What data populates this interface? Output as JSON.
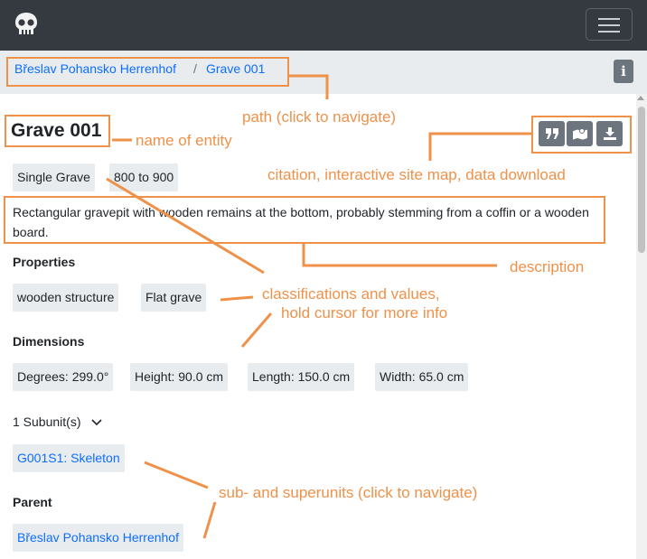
{
  "navbar": {
    "logo_icon": "skull-icon",
    "menu_icon": "hamburger-icon"
  },
  "breadcrumb": {
    "items": [
      "Břeslav Pohansko Herrenhof",
      "Grave 001"
    ],
    "separator": "/"
  },
  "info_button": {
    "label": "i"
  },
  "entity": {
    "title": "Grave 001",
    "actions": [
      "quote-icon",
      "map-icon",
      "download-icon"
    ],
    "tags": [
      "Single Grave",
      "800 to 900"
    ],
    "description": "Rectangular gravepit with wooden remains at the bottom, probably stemming from a coffin or a wooden board."
  },
  "properties": {
    "label": "Properties",
    "values": [
      "wooden structure",
      "Flat grave"
    ]
  },
  "dimensions": {
    "label": "Dimensions",
    "values": [
      "Degrees: 299.0°",
      "Height: 90.0 cm",
      "Length: 150.0 cm",
      "Width: 65.0 cm"
    ]
  },
  "subunits": {
    "toggle_label": "1 Subunit(s)",
    "items": [
      "G001S1: Skeleton"
    ]
  },
  "parent": {
    "label": "Parent",
    "items": [
      "Břeslav Pohansko Herrenhof"
    ]
  },
  "annotations": {
    "path": "path (click to navigate)",
    "name": "name of entity",
    "citation": "citation, interactive site map, data download",
    "description": "description",
    "classifications_1": "classifications and values,",
    "classifications_2": "hold cursor for more info",
    "subunits": "sub- and superunits (click to navigate)",
    "color": "#f0914a"
  },
  "colors": {
    "navbar": "#343a40",
    "link": "#0d6efd",
    "chip": "#e9ecef",
    "button": "#6c757d"
  }
}
